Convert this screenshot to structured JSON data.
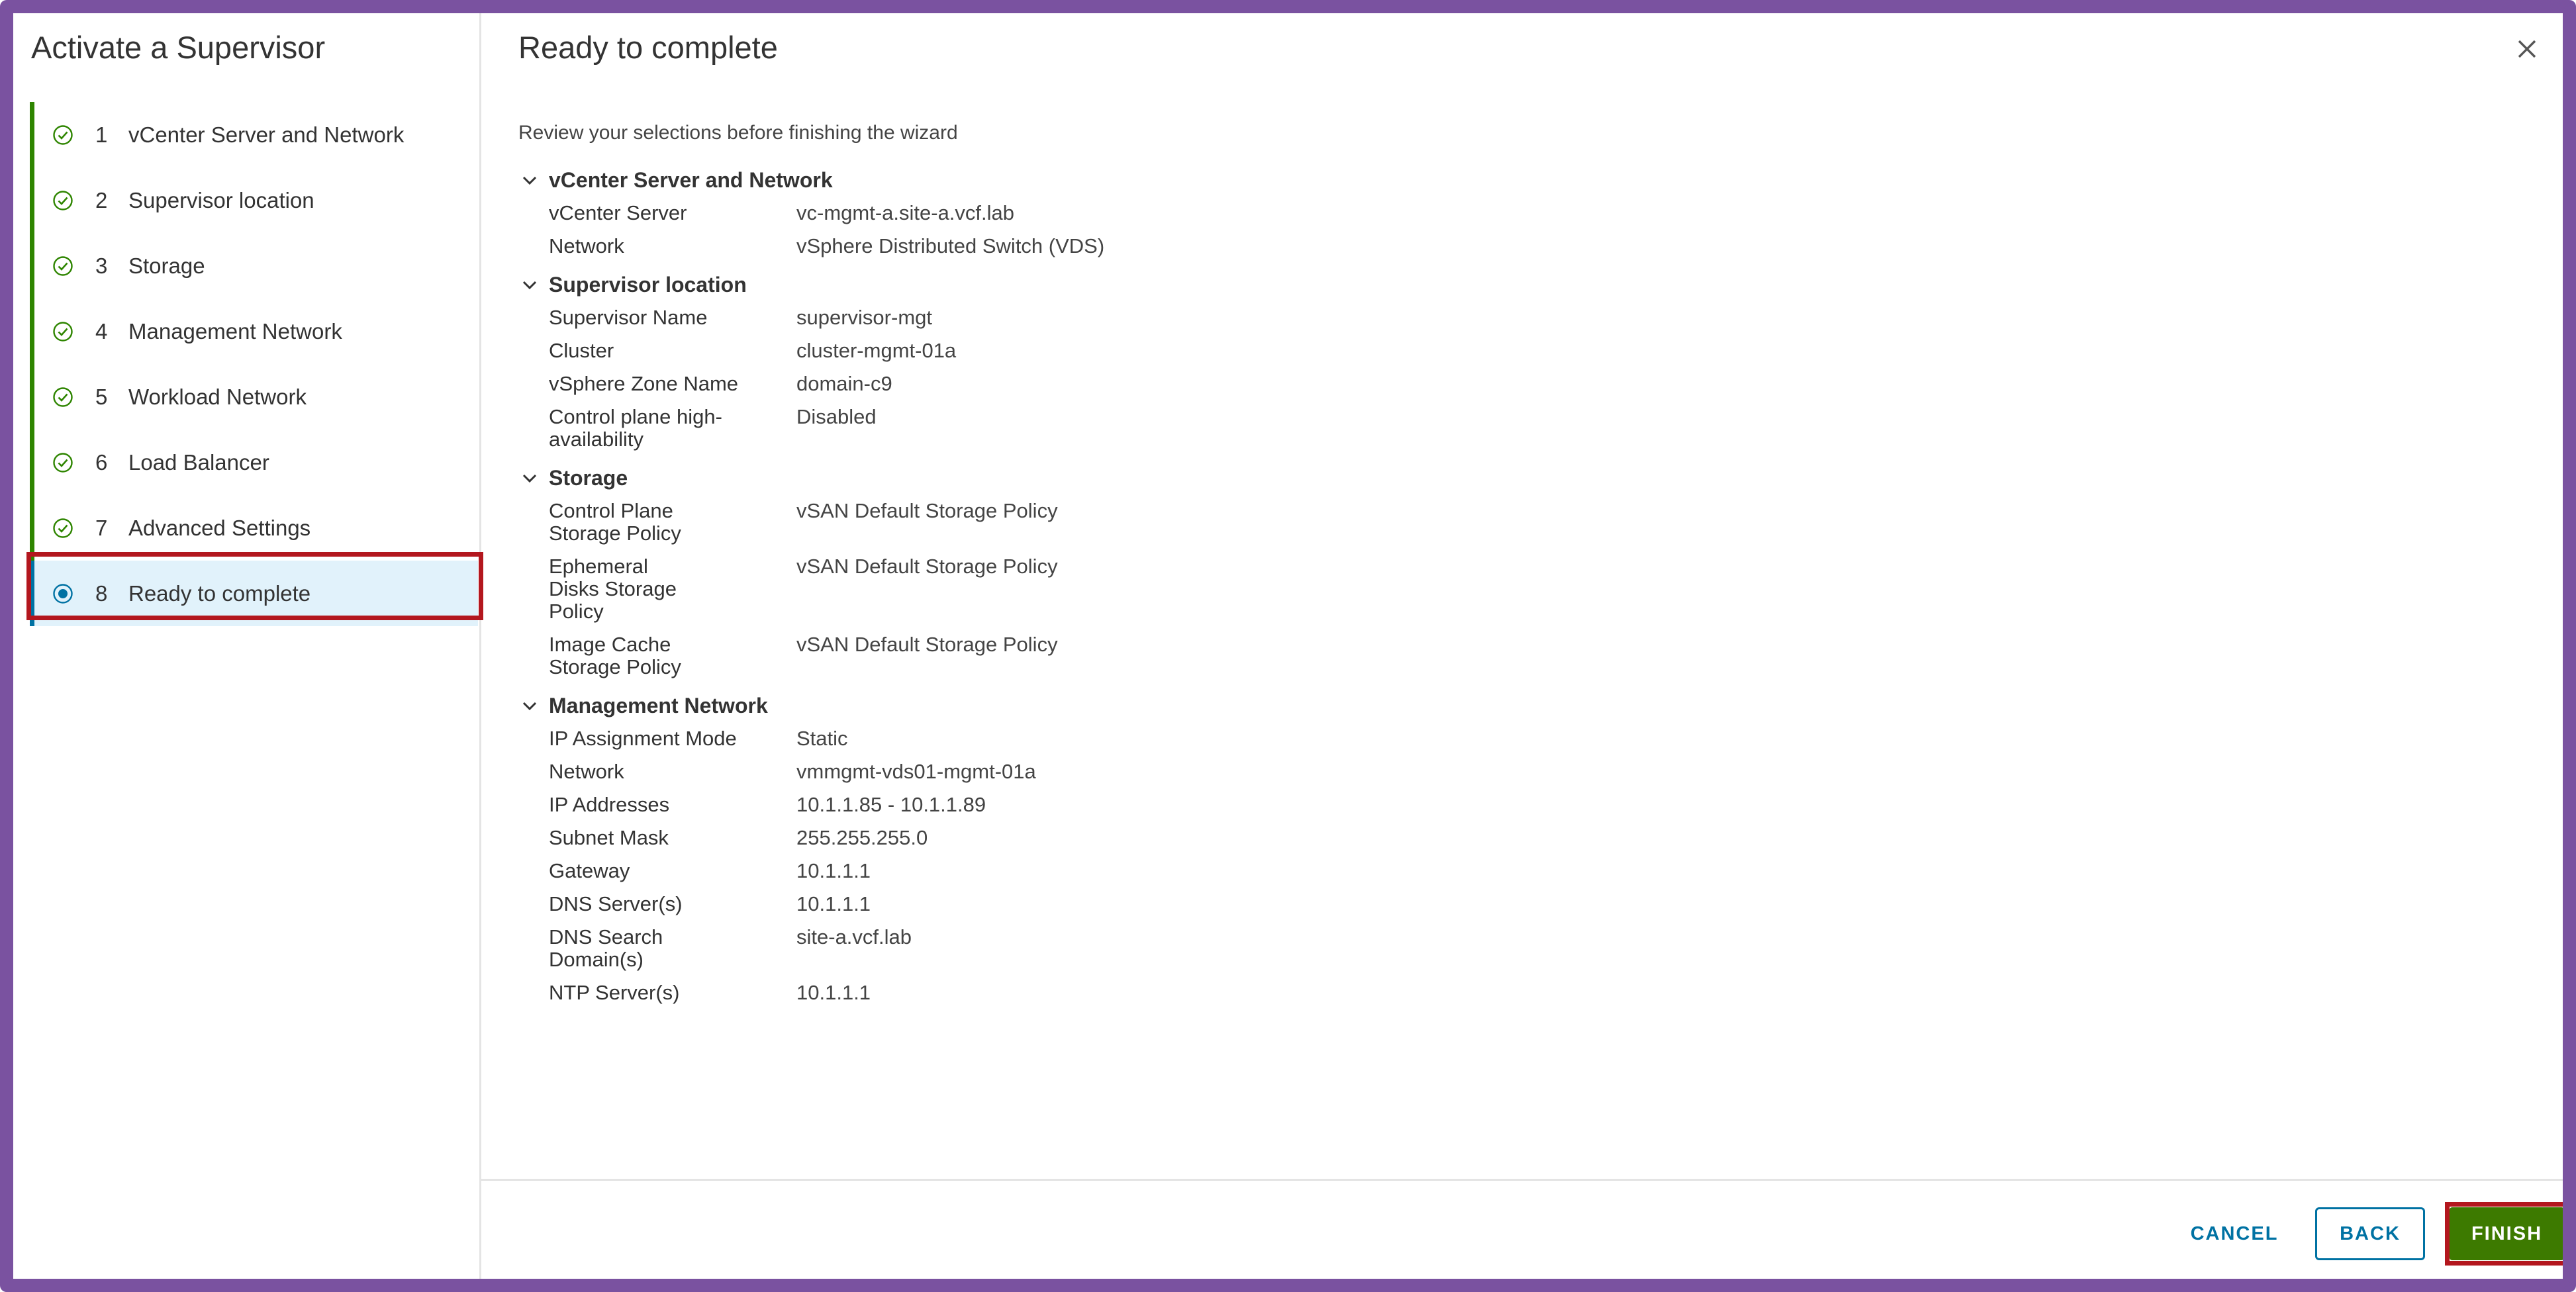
{
  "wizard": {
    "title": "Activate a Supervisor",
    "steps": [
      {
        "number": "1",
        "label": "vCenter Server and Network",
        "status": "complete"
      },
      {
        "number": "2",
        "label": "Supervisor location",
        "status": "complete"
      },
      {
        "number": "3",
        "label": "Storage",
        "status": "complete"
      },
      {
        "number": "4",
        "label": "Management Network",
        "status": "complete"
      },
      {
        "number": "5",
        "label": "Workload Network",
        "status": "complete"
      },
      {
        "number": "6",
        "label": "Load Balancer",
        "status": "complete"
      },
      {
        "number": "7",
        "label": "Advanced Settings",
        "status": "complete"
      },
      {
        "number": "8",
        "label": "Ready to complete",
        "status": "current"
      }
    ]
  },
  "page": {
    "title": "Ready to complete",
    "intro": "Review your selections before finishing the wizard"
  },
  "sections": [
    {
      "title": "vCenter Server and Network",
      "rows": [
        {
          "key": "vCenter Server",
          "value": "vc-mgmt-a.site-a.vcf.lab"
        },
        {
          "key": "Network",
          "value": "vSphere Distributed Switch (VDS)"
        }
      ]
    },
    {
      "title": "Supervisor location",
      "rows": [
        {
          "key": "Supervisor Name",
          "value": "supervisor-mgt"
        },
        {
          "key": "Cluster",
          "value": "cluster-mgmt-01a"
        },
        {
          "key": "vSphere Zone Name",
          "value": "domain-c9"
        },
        {
          "key": "Control plane high-availability",
          "value": "Disabled"
        }
      ]
    },
    {
      "title": "Storage",
      "rows": [
        {
          "key": "Control Plane Storage Policy",
          "value": "vSAN Default Storage Policy"
        },
        {
          "key": "Ephemeral Disks Storage Policy",
          "value": "vSAN Default Storage Policy"
        },
        {
          "key": "Image Cache Storage Policy",
          "value": "vSAN Default Storage Policy"
        }
      ]
    },
    {
      "title": "Management Network",
      "rows": [
        {
          "key": "IP Assignment Mode",
          "value": "Static"
        },
        {
          "key": "Network",
          "value": "vmmgmt-vds01-mgmt-01a"
        },
        {
          "key": "IP Addresses",
          "value": "10.1.1.85 - 10.1.1.89"
        },
        {
          "key": "Subnet Mask",
          "value": "255.255.255.0"
        },
        {
          "key": "Gateway",
          "value": "10.1.1.1"
        },
        {
          "key": "DNS Server(s)",
          "value": "10.1.1.1"
        },
        {
          "key": "DNS Search Domain(s)",
          "value": "site-a.vcf.lab"
        },
        {
          "key": "NTP Server(s)",
          "value": "10.1.1.1"
        }
      ]
    }
  ],
  "footer": {
    "cancel_label": "CANCEL",
    "back_label": "BACK",
    "finish_label": "FINISH"
  },
  "colors": {
    "frame_border": "#7a52a0",
    "step_complete": "#2e8500",
    "step_current": "#0072a3",
    "finish_button": "#3d7a00",
    "highlight_box": "#b3171e"
  },
  "icons": {
    "step_complete": "check-circle-icon",
    "step_current": "radio-dot-icon",
    "section_toggle": "chevron-down-icon",
    "close": "close-icon"
  }
}
